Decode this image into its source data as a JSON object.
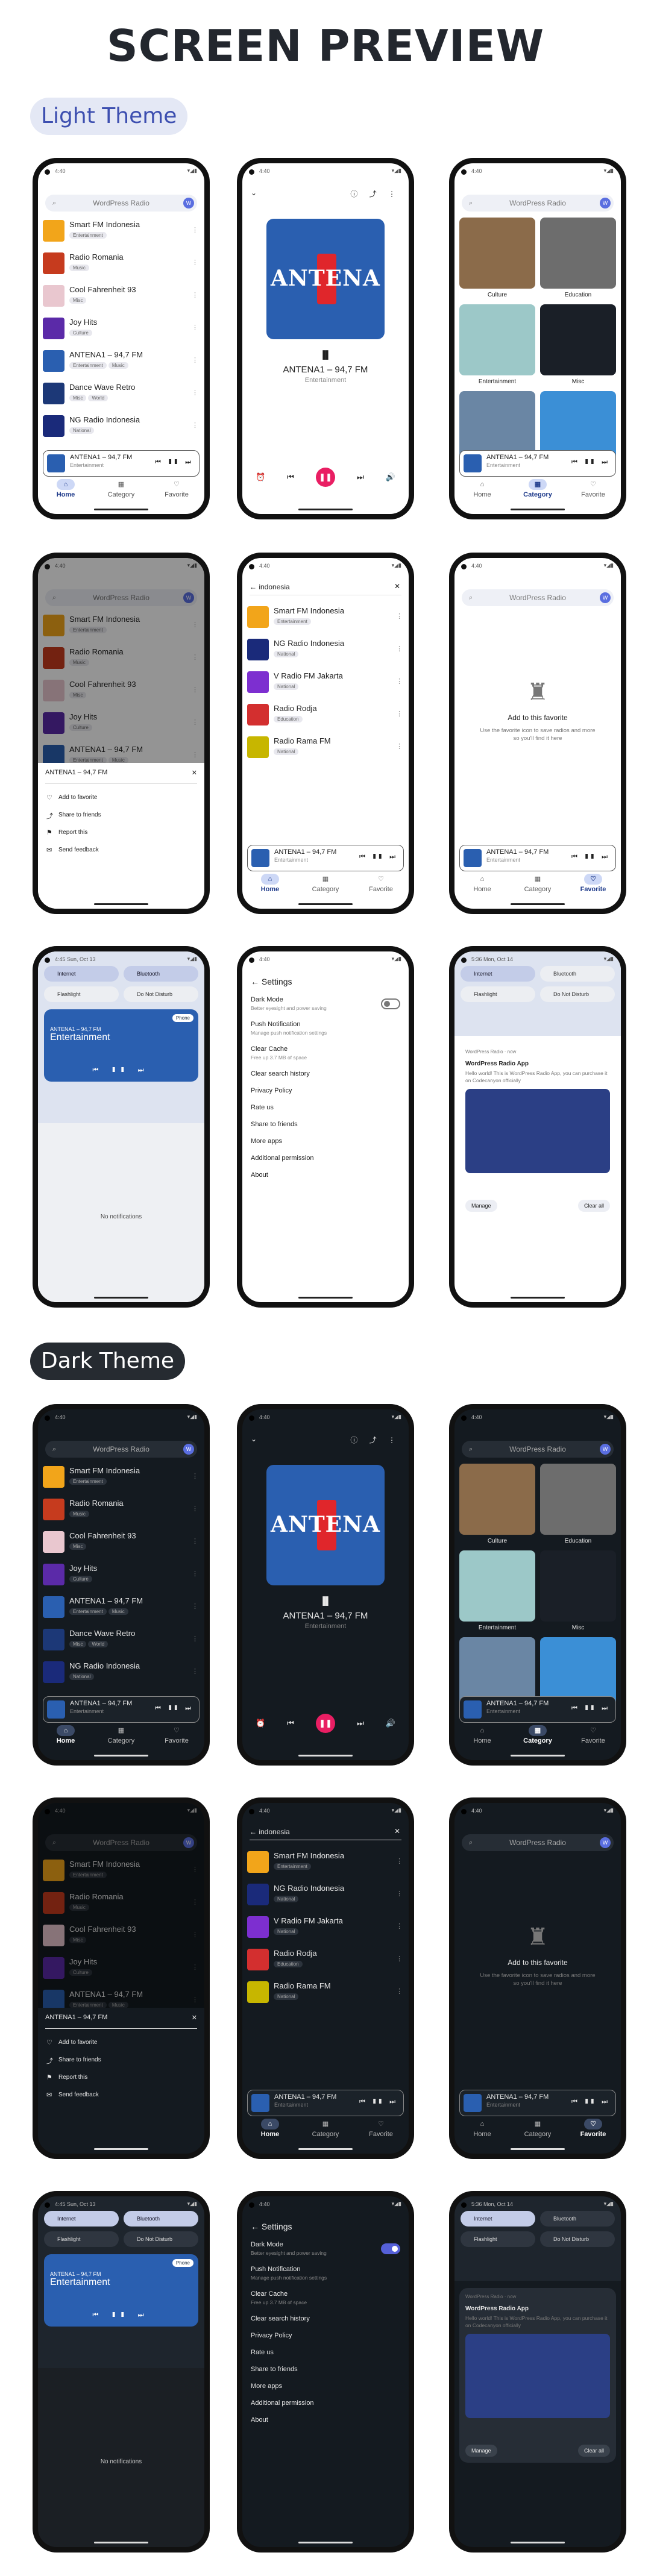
{
  "title": "SCREEN PREVIEW",
  "light_label": "Light Theme",
  "dark_label": "Dark Theme",
  "status": {
    "time1": "4:40",
    "time2": "4:45 Sun, Oct 13",
    "time3": "5:36 Mon, Oct 14",
    "icons": "▾◢▮"
  },
  "search": {
    "placeholder": "WordPress Radio"
  },
  "stations": [
    {
      "name": "Smart FM Indonesia",
      "tags": [
        "Entertainment"
      ],
      "color": "#f2a51a"
    },
    {
      "name": "Radio Romania",
      "tags": [
        "Music"
      ],
      "color": "#c63b1e"
    },
    {
      "name": "Cool Fahrenheit 93",
      "tags": [
        "Misc"
      ],
      "color": "#e9c7cf"
    },
    {
      "name": "Joy Hits",
      "tags": [
        "Culture"
      ],
      "color": "#5b2aa8"
    },
    {
      "name": "ANTENA1 – 94,7 FM",
      "tags": [
        "Entertainment",
        "Music"
      ],
      "color": "#2a5fb0"
    },
    {
      "name": "Dance Wave Retro",
      "tags": [
        "Misc",
        "World"
      ],
      "color": "#1c3877"
    },
    {
      "name": "NG Radio Indonesia",
      "tags": [
        "National"
      ],
      "color": "#1a2a7a"
    }
  ],
  "search_results": [
    {
      "name": "Smart FM Indonesia",
      "tags": [
        "Entertainment"
      ],
      "color": "#f2a51a"
    },
    {
      "name": "NG Radio Indonesia",
      "tags": [
        "National"
      ],
      "color": "#1a2a7a"
    },
    {
      "name": "V Radio FM Jakarta",
      "tags": [
        "National"
      ],
      "color": "#7d2fd0"
    },
    {
      "name": "Radio Rodja",
      "tags": [
        "Education"
      ],
      "color": "#d32f2f"
    },
    {
      "name": "Radio Rama FM",
      "tags": [
        "National"
      ],
      "color": "#c7b600"
    }
  ],
  "search_query": "indonesia",
  "mini": {
    "title": "ANTENA1 – 94,7 FM",
    "sub": "Entertainment",
    "ctl": "⏮ ❚❚ ⏭"
  },
  "nav": {
    "home": "Home",
    "category": "Category",
    "favorite": "Favorite"
  },
  "categories": [
    {
      "label": "Culture",
      "color": "#8b6b4a"
    },
    {
      "label": "Education",
      "color": "#6d6d6d"
    },
    {
      "label": "Entertainment",
      "color": "#9cc8c8"
    },
    {
      "label": "Misc",
      "color": "#1a1f27"
    },
    {
      "label": "",
      "color": "#6a86a4"
    },
    {
      "label": "",
      "color": "#3b8fd6"
    }
  ],
  "player": {
    "logo": "ANTENA",
    "title": "ANTENA1 – 94,7 FM",
    "category": "Entertainment",
    "eq": "▐▌",
    "play": "❚❚",
    "prev": "⏮",
    "next": "⏭",
    "timer": "⏰",
    "vol": "🔊",
    "down": "⌄",
    "top_icons": "ⓘ ⤴ ⋮"
  },
  "sheet": {
    "title": "ANTENA1 – 94,7 FM",
    "items": [
      "Add to favorite",
      "Share to friends",
      "Report this",
      "Send feedback"
    ]
  },
  "favorite_empty": {
    "title": "Add to this favorite",
    "body": "Use the favorite icon to save radios and more so you'll find it here"
  },
  "qs": {
    "internet": "Internet",
    "bluetooth": "Bluetooth",
    "flashlight": "Flashlight",
    "dnd": "Do Not Disturb",
    "media_title": "ANTENA1 – 94,7 FM",
    "media_sub": "Entertainment",
    "device": "Phone",
    "no_noti": "No notifications"
  },
  "settings": {
    "title": "Settings",
    "items": [
      {
        "label": "Dark Mode",
        "sub": "Better eyesight and power saving"
      },
      {
        "label": "Push Notification",
        "sub": "Manage push notification settings"
      },
      {
        "label": "Clear Cache",
        "sub": "Free up 3.7 MB of space"
      },
      {
        "label": "Clear search history",
        "sub": ""
      },
      {
        "label": "Privacy Policy",
        "sub": ""
      },
      {
        "label": "Rate us",
        "sub": ""
      },
      {
        "label": "Share to friends",
        "sub": ""
      },
      {
        "label": "More apps",
        "sub": ""
      },
      {
        "label": "Additional permission",
        "sub": ""
      },
      {
        "label": "About",
        "sub": ""
      }
    ]
  },
  "noti": {
    "app": "WordPress Radio · now",
    "title": "WordPress Radio App",
    "body": "Hello world! This is WordPress Radio App, you can purchase it on Codecanyon officially",
    "manage": "Manage",
    "clear": "Clear all"
  }
}
